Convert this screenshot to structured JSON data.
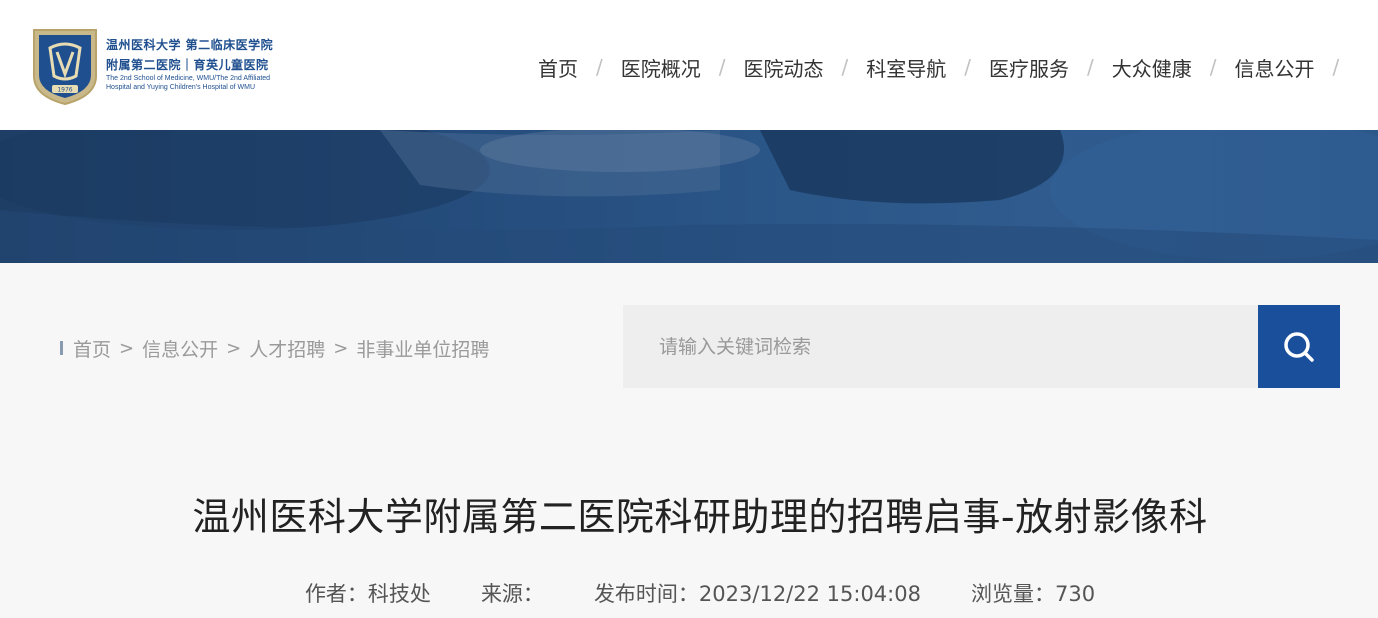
{
  "logo": {
    "emblem_year": "1976",
    "line1": "温州医科大学 第二临床医学院",
    "line2": "附属第二医院｜育英儿童医院",
    "line3": "The 2nd School of Medicine, WMU/The 2nd Affiliated",
    "line4": "Hospital and Yuying Children's Hospital of WMU"
  },
  "nav": {
    "items": [
      "首页",
      "医院概况",
      "医院动态",
      "科室导航",
      "医疗服务",
      "大众健康",
      "信息公开"
    ],
    "separator": "/"
  },
  "breadcrumb": {
    "items": [
      "首页",
      "信息公开",
      "人才招聘",
      "非事业单位招聘"
    ],
    "separator": ">"
  },
  "search": {
    "placeholder": "请输入关键词检索",
    "icon": "search-icon",
    "button_color": "#1a4f9c"
  },
  "article": {
    "title": "温州医科大学附属第二医院科研助理的招聘启事-放射影像科",
    "author": "作者：科技处",
    "source": "来源：",
    "published": "发布时间：2023/12/22 15:04:08",
    "views": "浏览量：730"
  }
}
